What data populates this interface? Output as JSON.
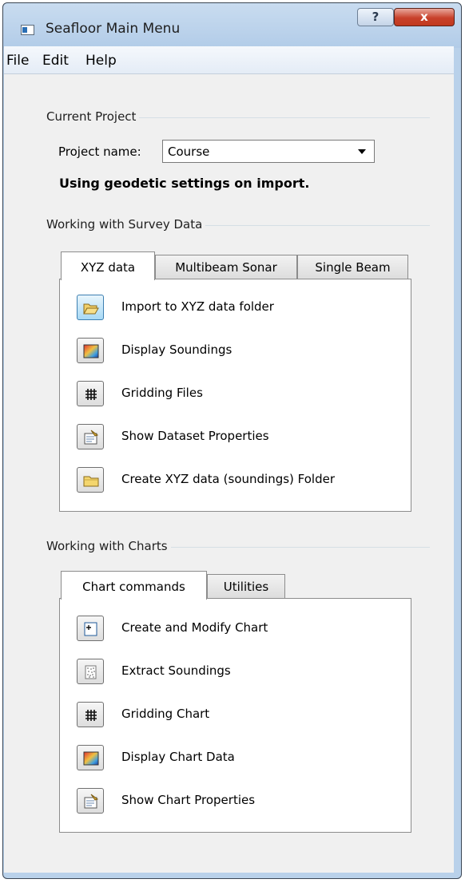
{
  "window": {
    "title": "Seafloor Main Menu",
    "help_button": "?",
    "close_button": "x"
  },
  "menu": [
    "File",
    "Edit",
    "Help"
  ],
  "current_project": {
    "group_title": "Current Project",
    "project_label": "Project name:",
    "project_value": "Course",
    "geodetic_note": "Using geodetic settings on import."
  },
  "survey": {
    "group_title": "Working with Survey Data",
    "tabs": [
      "XYZ data",
      "Multibeam Sonar",
      "Single Beam"
    ],
    "commands": [
      {
        "label": "Import to XYZ data folder",
        "icon": "open-folder-icon"
      },
      {
        "label": "Display Soundings",
        "icon": "color-gradient-icon"
      },
      {
        "label": "Gridding Files",
        "icon": "grid-icon"
      },
      {
        "label": "Show Dataset Properties",
        "icon": "properties-icon"
      },
      {
        "label": "Create XYZ data (soundings) Folder",
        "icon": "folder-icon"
      }
    ]
  },
  "charts": {
    "group_title": "Working with Charts",
    "tabs": [
      "Chart commands",
      "Utilities"
    ],
    "commands": [
      {
        "label": "Create and Modify Chart",
        "icon": "new-chart-icon"
      },
      {
        "label": "Extract Soundings",
        "icon": "soundings-icon"
      },
      {
        "label": "Gridding Chart",
        "icon": "grid-icon"
      },
      {
        "label": "Display Chart Data",
        "icon": "color-gradient-icon"
      },
      {
        "label": "Show Chart Properties",
        "icon": "properties-icon"
      }
    ]
  }
}
